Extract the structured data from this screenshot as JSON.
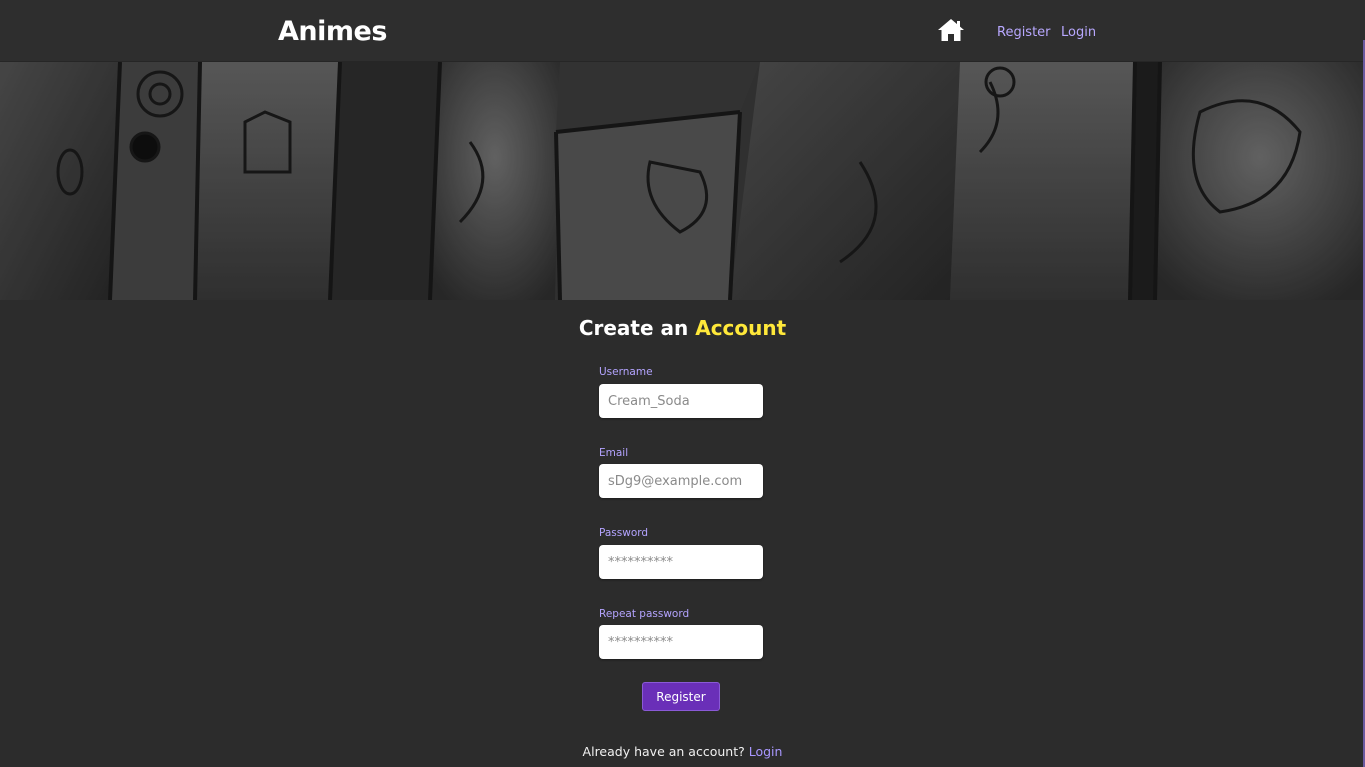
{
  "header": {
    "brand": "Animes",
    "home_icon": "home-icon",
    "nav": {
      "register": "Register",
      "login": "Login"
    }
  },
  "banner": {
    "description_icon": "manga-collage-banner"
  },
  "form": {
    "title_prefix": "Create an",
    "title_accent": "Account",
    "fields": {
      "username": {
        "label": "Username",
        "placeholder": "Cream_Soda"
      },
      "email": {
        "label": "Email",
        "placeholder": "sDg9@example.com"
      },
      "password": {
        "label": "Password",
        "placeholder": "**********"
      },
      "repeat_password": {
        "label": "Repeat password",
        "placeholder": "**********"
      }
    },
    "submit_label": "Register",
    "footer_prefix": "Already have an account?",
    "footer_link": "Login"
  },
  "colors": {
    "background": "#2c2c2c",
    "accent_yellow": "#ffe83a",
    "link_purple": "#b8a8ff",
    "button_purple": "#6a2fb8"
  }
}
